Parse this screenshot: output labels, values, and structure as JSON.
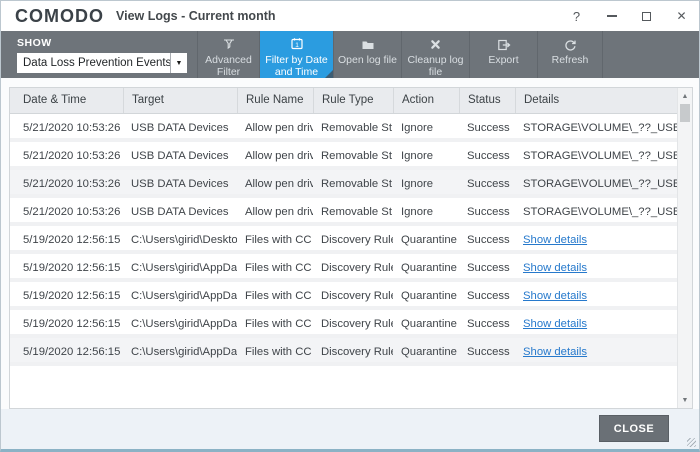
{
  "window": {
    "logo": "COMODO",
    "title": "View Logs - Current month",
    "controls": {
      "help": "?",
      "minimize": "–",
      "close": "✕"
    }
  },
  "toolbar": {
    "show_label": "SHOW",
    "dropdown_value": "Data Loss Prevention Events",
    "buttons": [
      {
        "id": "advanced-filter",
        "label": "Advanced Filter",
        "icon": "funnel-icon",
        "active": false
      },
      {
        "id": "filter-by-date",
        "label": "Filter by Date and Time",
        "icon": "calendar-icon",
        "active": true
      },
      {
        "id": "open-log-file",
        "label": "Open log file",
        "icon": "folder-icon",
        "active": false
      },
      {
        "id": "cleanup-log-file",
        "label": "Cleanup log file",
        "icon": "x-icon",
        "active": false
      },
      {
        "id": "export",
        "label": "Export",
        "icon": "export-icon",
        "active": false
      },
      {
        "id": "refresh",
        "label": "Refresh",
        "icon": "refresh-icon",
        "active": false
      }
    ]
  },
  "table": {
    "columns": [
      "Date & Time",
      "Target",
      "Rule Name",
      "Rule Type",
      "Action",
      "Status",
      "Details"
    ],
    "shaded_rows": [
      2,
      8
    ],
    "rows": [
      {
        "date": "5/21/2020 10:53:26 ...",
        "target": "USB DATA Devices",
        "rule_name": "Allow pen drive",
        "rule_type": "Removable St...",
        "action": "Ignore",
        "status": "Success",
        "details": "STORAGE\\VOLUME\\_??_USBSTO...",
        "details_is_link": false
      },
      {
        "date": "5/21/2020 10:53:26 ...",
        "target": "USB DATA Devices",
        "rule_name": "Allow pen drive",
        "rule_type": "Removable St...",
        "action": "Ignore",
        "status": "Success",
        "details": "STORAGE\\VOLUME\\_??_USBSTO...",
        "details_is_link": false
      },
      {
        "date": "5/21/2020 10:53:26 ...",
        "target": "USB DATA Devices",
        "rule_name": "Allow pen drive",
        "rule_type": "Removable St...",
        "action": "Ignore",
        "status": "Success",
        "details": "STORAGE\\VOLUME\\_??_USBSTO...",
        "details_is_link": false
      },
      {
        "date": "5/21/2020 10:53:26 ...",
        "target": "USB DATA Devices",
        "rule_name": "Allow pen drive",
        "rule_type": "Removable St...",
        "action": "Ignore",
        "status": "Success",
        "details": "STORAGE\\VOLUME\\_??_USBSTO...",
        "details_is_link": false
      },
      {
        "date": "5/19/2020 12:56:15 ...",
        "target": "C:\\Users\\girid\\Deskto...",
        "rule_name": "Files with CC ...",
        "rule_type": "Discovery Rule",
        "action": "Quarantine",
        "status": "Success",
        "details": "Show details",
        "details_is_link": true
      },
      {
        "date": "5/19/2020 12:56:15 ...",
        "target": "C:\\Users\\girid\\AppDa...",
        "rule_name": "Files with CC ...",
        "rule_type": "Discovery Rule",
        "action": "Quarantine",
        "status": "Success",
        "details": "Show details",
        "details_is_link": true
      },
      {
        "date": "5/19/2020 12:56:15 ...",
        "target": "C:\\Users\\girid\\AppDa...",
        "rule_name": "Files with CC ...",
        "rule_type": "Discovery Rule",
        "action": "Quarantine",
        "status": "Success",
        "details": "Show details",
        "details_is_link": true
      },
      {
        "date": "5/19/2020 12:56:15 ...",
        "target": "C:\\Users\\girid\\AppDa...",
        "rule_name": "Files with CC ...",
        "rule_type": "Discovery Rule",
        "action": "Quarantine",
        "status": "Success",
        "details": "Show details",
        "details_is_link": true
      },
      {
        "date": "5/19/2020 12:56:15 ...",
        "target": "C:\\Users\\girid\\AppDa...",
        "rule_name": "Files with CC ...",
        "rule_type": "Discovery Rule",
        "action": "Quarantine",
        "status": "Success",
        "details": "Show details",
        "details_is_link": true
      }
    ]
  },
  "footer": {
    "close_label": "CLOSE"
  },
  "colors": {
    "toolbar_bg": "#6e747a",
    "active_button": "#2b9ce0",
    "link": "#2679cc",
    "close_button": "#6a7076",
    "footer_bg": "#edf2f7",
    "header_bg": "#e9ebee"
  }
}
